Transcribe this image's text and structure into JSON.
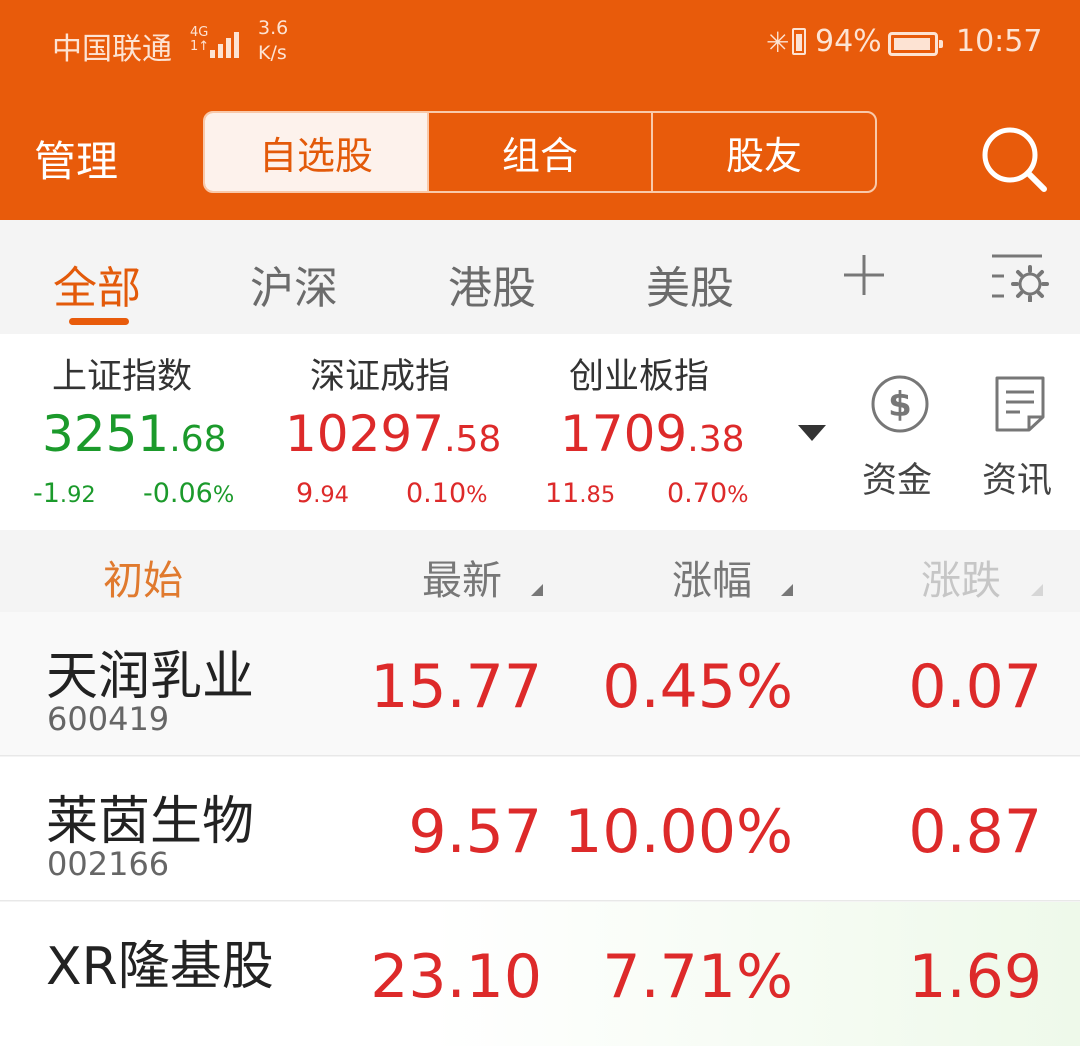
{
  "status_bar": {
    "carrier": "中国联通",
    "net_type": "4G",
    "net_sub": "1↑",
    "speed_value": "3.6",
    "speed_unit": "K/s",
    "battery_percent": "94%",
    "battery_level": 0.94,
    "time": "10:57"
  },
  "nav": {
    "manage": "管理",
    "segments": [
      "自选股",
      "组合",
      "股友"
    ],
    "active_segment": 0
  },
  "tabs": {
    "items": [
      "全部",
      "沪深",
      "港股",
      "美股"
    ],
    "active": 0
  },
  "indices": [
    {
      "name": "上证指数",
      "int": "3251",
      "dec": ".68",
      "chg_int": "-1",
      "chg_dec": ".92",
      "pct_main": "-0.06",
      "pct_sign": "%",
      "trend": "down"
    },
    {
      "name": "深证成指",
      "int": "10297",
      "dec": ".58",
      "chg_int": "9",
      "chg_dec": ".94",
      "pct_main": "0.10",
      "pct_sign": "%",
      "trend": "up"
    },
    {
      "name": "创业板指",
      "int": "1709",
      "dec": ".38",
      "chg_int": "11",
      "chg_dec": ".85",
      "pct_main": "0.70",
      "pct_sign": "%",
      "trend": "up"
    }
  ],
  "shortcuts": [
    {
      "label": "资金",
      "icon": "dollar-circle-icon"
    },
    {
      "label": "资讯",
      "icon": "news-doc-icon"
    }
  ],
  "columns": {
    "name": "初始",
    "price": "最新",
    "pct": "涨幅",
    "change": "涨跌"
  },
  "stocks": [
    {
      "name": "天润乳业",
      "code": "600419",
      "price": "15.77",
      "pct": "0.45%",
      "change": "0.07"
    },
    {
      "name": "莱茵生物",
      "code": "002166",
      "price": "9.57",
      "pct": "10.00%",
      "change": "0.87"
    },
    {
      "name": "XR隆基股",
      "code": "",
      "price": "23.10",
      "pct": "7.71%",
      "change": "1.69"
    }
  ],
  "colors": {
    "brand_orange": "#e85b0b",
    "up_red": "#dd2a2a",
    "down_green": "#1b9a2b"
  }
}
